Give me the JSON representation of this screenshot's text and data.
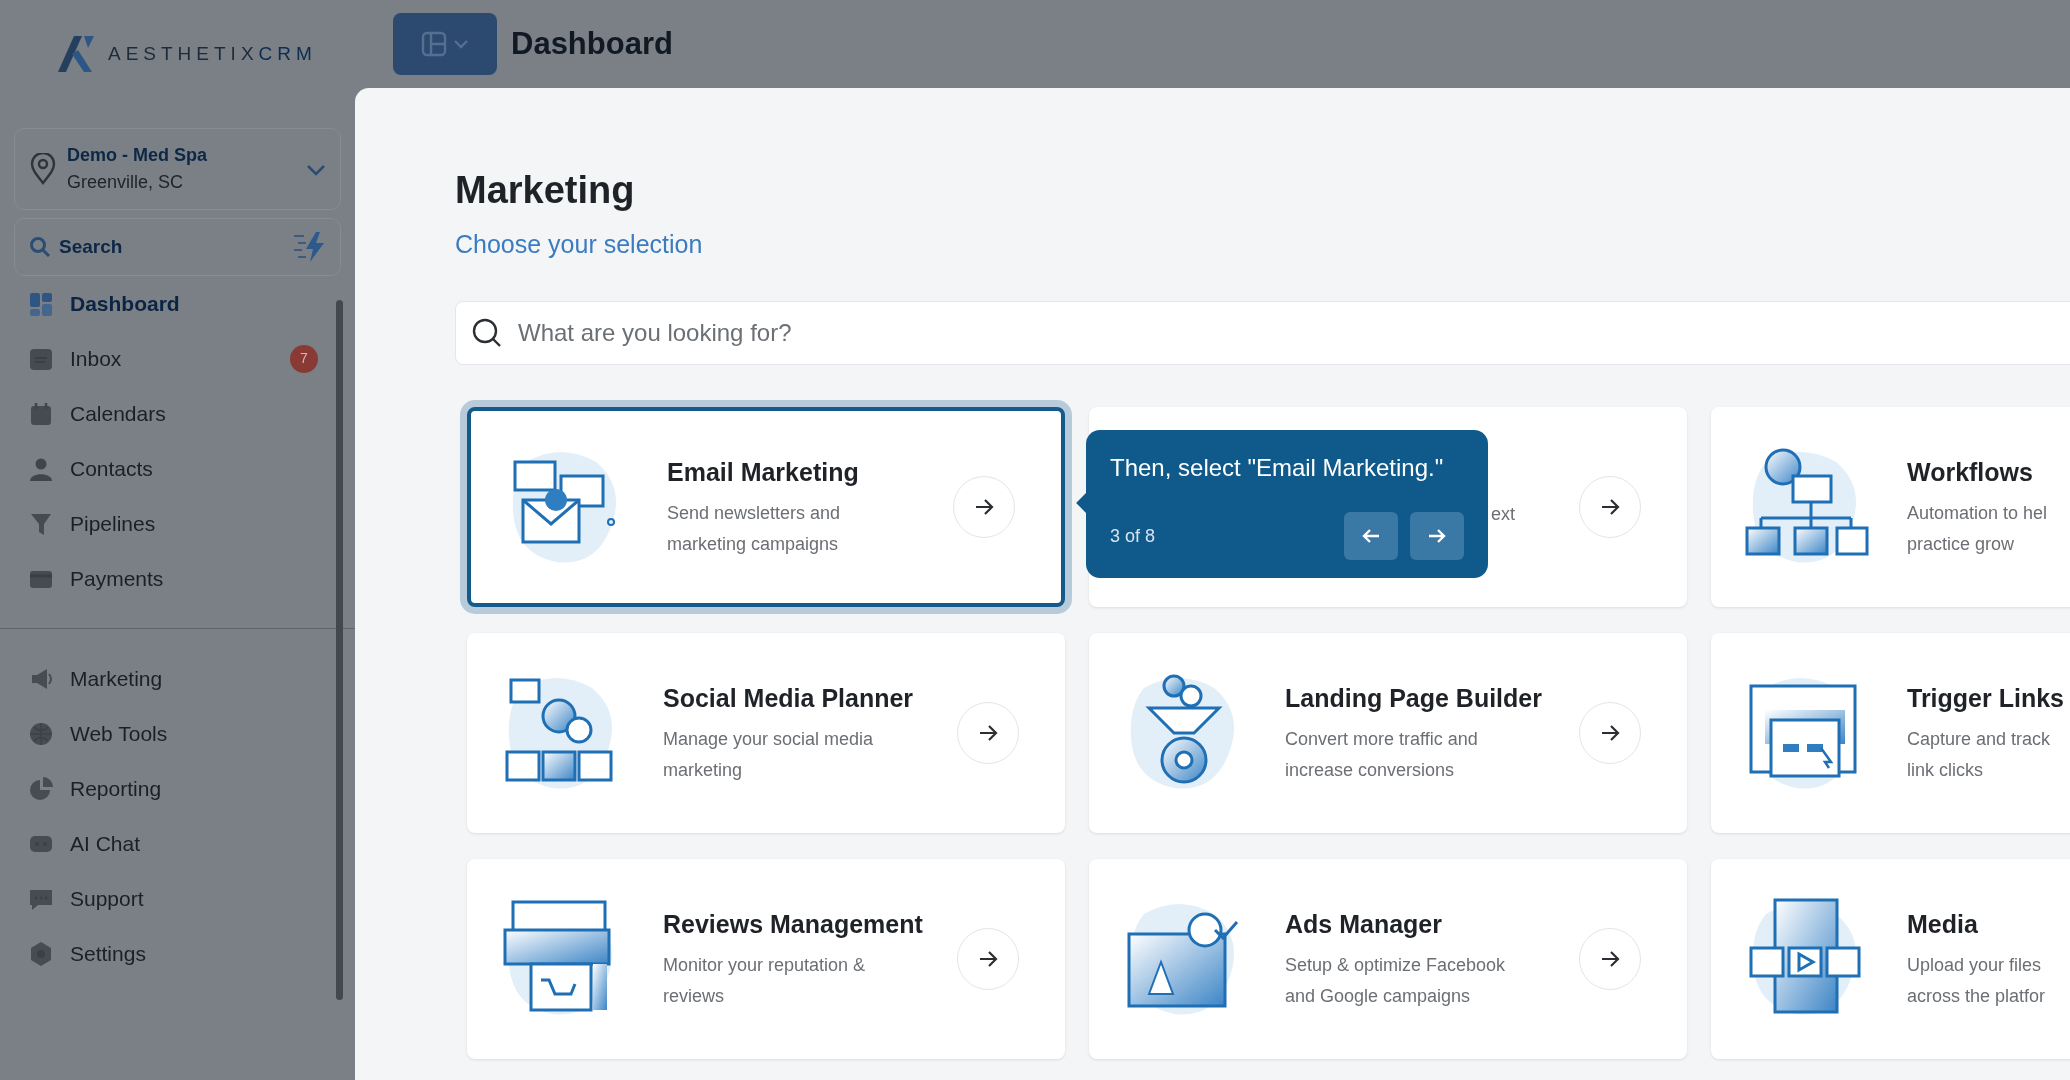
{
  "brand": {
    "name": "AESTHETIX",
    "suffix": "CRM"
  },
  "header": {
    "title": "Dashboard"
  },
  "location": {
    "name": "Demo - Med Spa",
    "address": "Greenville, SC"
  },
  "sidebar_search": {
    "label": "Search"
  },
  "nav": [
    {
      "label": "Dashboard",
      "selected": true
    },
    {
      "label": "Inbox",
      "selected": false,
      "badge": "7"
    },
    {
      "label": "Calendars",
      "selected": false
    },
    {
      "label": "Contacts",
      "selected": false
    },
    {
      "label": "Pipelines",
      "selected": false
    },
    {
      "label": "Payments",
      "selected": false
    }
  ],
  "nav_secondary": [
    {
      "label": "Marketing",
      "selected": false
    },
    {
      "label": "Web Tools",
      "selected": false
    },
    {
      "label": "Reporting",
      "selected": false
    },
    {
      "label": "AI Chat",
      "selected": false
    },
    {
      "label": "Support",
      "selected": false
    },
    {
      "label": "Settings",
      "selected": false
    }
  ],
  "page": {
    "title": "Marketing",
    "subtitle": "Choose your selection",
    "search_placeholder": "What are you looking for?"
  },
  "cards": [
    {
      "kind": "email",
      "title": "Email Marketing",
      "lines": [
        "Send newsletters and",
        "marketing campaigns"
      ],
      "highlighted": true
    },
    {
      "kind": "covered",
      "lines": [
        "ext"
      ],
      "highlighted": false
    },
    {
      "kind": "workflows",
      "title": "Workflows",
      "lines": [
        "Automation to hel",
        "practice grow"
      ],
      "highlighted": false
    },
    {
      "kind": "social",
      "title": "Social Media Planner",
      "lines": [
        "Manage your social media",
        "marketing"
      ],
      "highlighted": false
    },
    {
      "kind": "landing",
      "title": "Landing Page Builder",
      "lines": [
        "Convert more traffic and",
        "increase conversions"
      ],
      "highlighted": false
    },
    {
      "kind": "trigger",
      "title": "Trigger Links",
      "lines": [
        "Capture and track",
        "link clicks"
      ],
      "highlighted": false
    },
    {
      "kind": "reviews",
      "title": "Reviews Management",
      "lines": [
        "Monitor your reputation &",
        "reviews"
      ],
      "highlighted": false
    },
    {
      "kind": "ads",
      "title": "Ads Manager",
      "lines": [
        "Setup & optimize Facebook",
        "and Google campaigns"
      ],
      "highlighted": false
    },
    {
      "kind": "media",
      "title": "Media",
      "lines": [
        "Upload your files",
        "across the platfor"
      ],
      "highlighted": false
    }
  ],
  "tour": {
    "text": "Then, select \"Email Marketing.\"",
    "step": "3 of 8"
  }
}
